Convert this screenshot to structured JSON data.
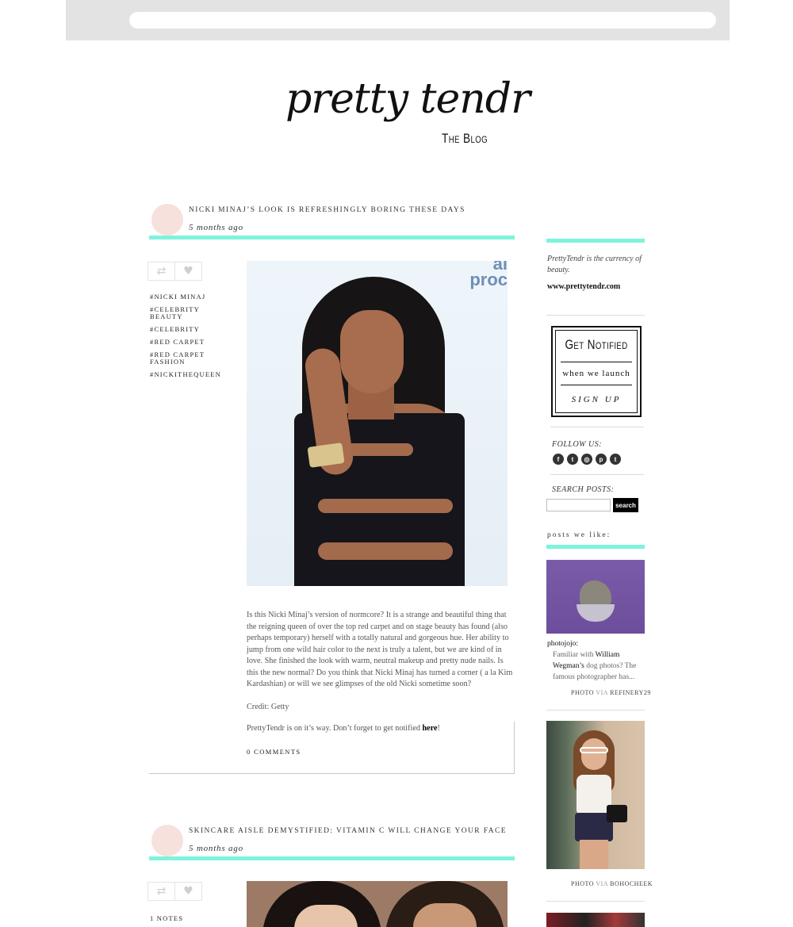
{
  "blog": {
    "logo_script": "pretty tendr",
    "logo_sub": "The Blog"
  },
  "posts": [
    {
      "title": "Nicki Minaj’s Look is Refreshingly Boring These Days",
      "date": "5 months ago",
      "tags": [
        "#Nicki Minaj",
        "#Celebrity Beauty",
        "#Celebrity",
        "#red carpet",
        "#red carpet fashion",
        "#NickiTheQueen"
      ],
      "body": "Is this Nicki Minaj’s version of normcore? It is a strange and beautiful thing that the reigning queen of over the top red carpet and on stage beauty has found (also perhaps temporary) herself with a totally natural and gorgeous hue. Her ability to jump from one wild hair color to the next is truly a talent, but we are kind of in love. She finished the look with warm, neutral makeup and pretty nude nails. Is this the new normal? Do you think that Nicki Minaj has turned a corner ( a la Kim Kardashian) or will we see glimpses of the old Nicki sometime soon?",
      "credit": "Credit: Getty",
      "notify_text": "PrettyTendr is on it’s way. Don’t forget to get notified ",
      "notify_link": "here",
      "notify_end": "!",
      "comments": "0 Comments",
      "photo_logo_text": "ab\nproc"
    },
    {
      "title": "Skincare Aisle Demystified: Vitamin C will Change your Face",
      "date": "5 months ago",
      "notes": "1 notes"
    }
  ],
  "actions": {
    "reblog_icon": "reblog-icon",
    "like_icon": "heart-icon"
  },
  "sidebar": {
    "description": "PrettyTendr is the currency of beauty.",
    "url": "www.prettytendr.com",
    "notify": {
      "title": "Get Notified",
      "middle": "when we launch",
      "action": "sign up"
    },
    "follow_label": "Follow us:",
    "social": [
      "f",
      "t",
      "◎",
      "p",
      "t"
    ],
    "search_label": "Search posts:",
    "search_value": "",
    "search_button": "search",
    "likes_label": "posts we like:",
    "liked": [
      {
        "source": "photojojo",
        "source_suffix": ":",
        "desc_before": "Familiar with ",
        "desc_link": "William Wegman’s",
        "desc_after": " dog photos? The famous photographer has...",
        "photo": "Photo",
        "via": "via",
        "via_source": "refinery29"
      },
      {
        "photo": "Photo",
        "via": "via",
        "via_source": "bohocheek"
      }
    ]
  },
  "colors": {
    "accent": "#7ff3dc",
    "avatar": "#f7e1dd",
    "chrome": "#e3e3e3"
  }
}
